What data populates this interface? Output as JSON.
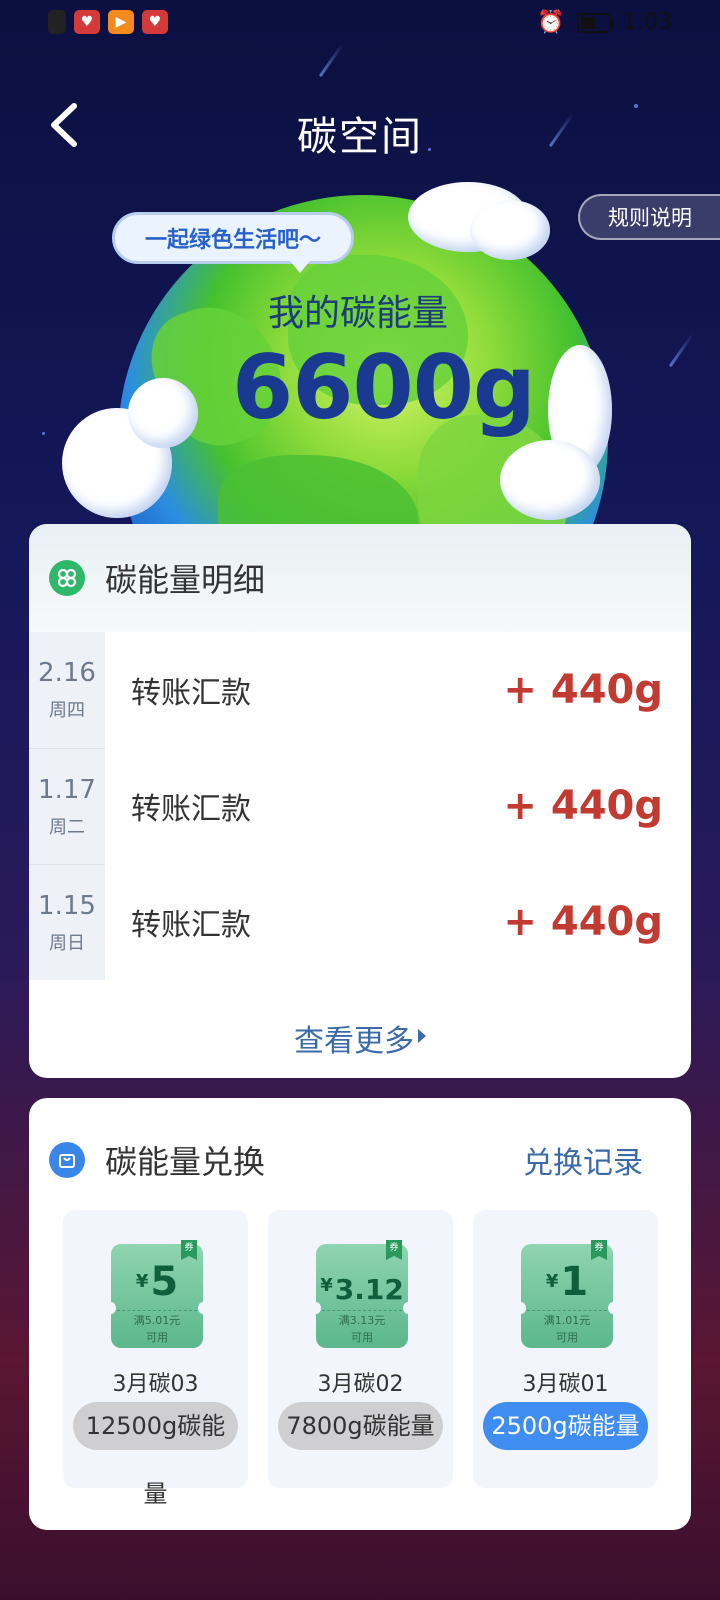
{
  "status_bar": {
    "time": "1:03"
  },
  "header": {
    "title": "碳空间",
    "rules": "规则说明"
  },
  "hero": {
    "slogan": "一起绿色生活吧～",
    "energy_label": "我的碳能量",
    "energy_value": "6600g"
  },
  "details": {
    "title": "碳能量明细",
    "rows": [
      {
        "date": "2.16",
        "weekday": "周四",
        "label": "转账汇款",
        "amount": "+ 440g"
      },
      {
        "date": "1.17",
        "weekday": "周二",
        "label": "转账汇款",
        "amount": "+ 440g"
      },
      {
        "date": "1.15",
        "weekday": "周日",
        "label": "转账汇款",
        "amount": "+ 440g"
      }
    ],
    "more": "查看更多"
  },
  "exchange": {
    "title": "碳能量兑换",
    "records": "兑换记录",
    "coupons": [
      {
        "yen": "¥",
        "value": "5",
        "condition": "满5.01元",
        "usable": "可用",
        "name": "3月碳03",
        "cost_line1": "12500g碳能",
        "cost_line2": "量",
        "tag": "券"
      },
      {
        "yen": "¥",
        "value": "3.12",
        "condition": "满3.13元",
        "usable": "可用",
        "name": "3月碳02",
        "cost_line1": "7800g碳能量",
        "tag": "券"
      },
      {
        "yen": "¥",
        "value": "1",
        "condition": "满1.01元",
        "usable": "可用",
        "name": "3月碳01",
        "cost_line1": "2500g碳能量",
        "tag": "券"
      }
    ]
  },
  "colors": {
    "accent_blue": "#3f8df0",
    "amount_red": "#c23b32",
    "link_blue": "#3a6aa8"
  }
}
